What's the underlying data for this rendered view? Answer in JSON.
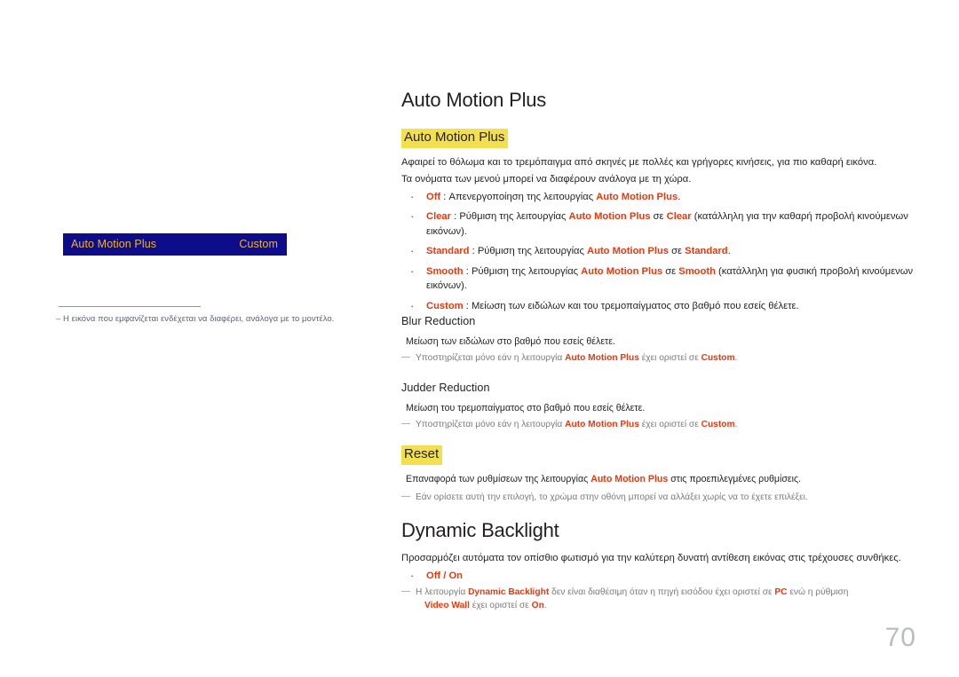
{
  "page": {
    "number": "70"
  },
  "osd": {
    "label": "Auto Motion Plus",
    "value": "Custom",
    "note_dash": "‒",
    "note": "Η εικόνα που εμφανίζεται ενδέχεται να διαφέρει, ανάλογα με το μοντέλο."
  },
  "colors": {
    "osd_background": "#0d0d8c",
    "osd_text": "#f0b323",
    "highlight": "#f2e04e",
    "accent_red": "#e8380d",
    "note_grey": "#7b7b7b",
    "page_number": "#b9bcc2"
  },
  "sections": {
    "auto_motion_plus": {
      "title": "Auto Motion Plus",
      "highlight_heading": "Auto Motion Plus",
      "intro_line_1": "Αφαιρεί το θόλωμα και το τρεμόπαιγμα από σκηνές με πολλές και γρήγορες κινήσεις, για πιο καθαρή εικόνα.",
      "intro_line_2": "Τα ονόματα των μενού μπορεί να διαφέρουν ανάλογα με τη χώρα.",
      "options": [
        {
          "key": "Off",
          "sep": " : ",
          "text_before": "Απενεργοποίηση της λειτουργίας ",
          "ref": "Auto Motion Plus",
          "text_after": "."
        },
        {
          "key": "Clear",
          "sep": " : ",
          "text_before": "Ρύθμιση της λειτουργίας ",
          "ref": "Auto Motion Plus",
          "mid": " σε ",
          "ref2": "Clear",
          "text_after": " (κατάλληλη για την καθαρή προβολή κινούμενων εικόνων)."
        },
        {
          "key": "Standard",
          "sep": " : ",
          "text_before": "Ρύθμιση της λειτουργίας ",
          "ref": "Auto Motion Plus",
          "mid": " σε ",
          "ref2": "Standard",
          "text_after": "."
        },
        {
          "key": "Smooth",
          "sep": " : ",
          "text_before": "Ρύθμιση της λειτουργίας ",
          "ref": "Auto Motion Plus",
          "mid": " σε ",
          "ref2": "Smooth",
          "text_after": " (κατάλληλη για φυσική προβολή κινούμενων εικόνων)."
        },
        {
          "key": "Custom",
          "sep": " : ",
          "text_before": "Μείωση των ειδώλων και του τρεμοπαίγματος στο βαθμό που εσείς θέλετε.",
          "ref": "",
          "text_after": ""
        }
      ]
    },
    "blur_reduction": {
      "heading": "Blur Reduction",
      "description": "Μείωση των ειδώλων στο βαθμό που εσείς θέλετε.",
      "note_dash": "―",
      "note_before": "Υποστηρίζεται μόνο εάν η λειτουργία ",
      "note_ref": "Auto Motion Plus",
      "note_mid": " έχει οριστεί σε ",
      "note_ref2": "Custom",
      "note_after": "."
    },
    "judder_reduction": {
      "heading": "Judder Reduction",
      "description": "Μείωση του τρεμοπαίγματος στο βαθμό που εσείς θέλετε.",
      "note_dash": "―",
      "note_before": "Υποστηρίζεται μόνο εάν η λειτουργία ",
      "note_ref": "Auto Motion Plus",
      "note_mid": " έχει οριστεί σε ",
      "note_ref2": "Custom",
      "note_after": "."
    },
    "reset": {
      "highlight_heading": "Reset",
      "description_before": "Επαναφορά των ρυθμίσεων της λειτουργίας ",
      "description_ref": "Auto Motion Plus",
      "description_after": " στις προεπιλεγμένες ρυθμίσεις.",
      "note_dash": "―",
      "note": "Εάν ορίσετε αυτή την επιλογή, το χρώμα στην οθόνη μπορεί να αλλάξει χωρίς να το έχετε επιλέξει."
    },
    "dynamic_backlight": {
      "title": "Dynamic Backlight",
      "description": "Προσαρμόζει αυτόματα τον οπίσθιο φωτισμό για την καλύτερη δυνατή αντίθεση εικόνας στις τρέχουσες συνθήκες.",
      "option": "Off / On",
      "note_dash": "―",
      "note_before": "Η λειτουργία ",
      "note_ref": "Dynamic Backlight",
      "note_mid": " δεν είναι διαθέσιμη όταν η πηγή εισόδου έχει οριστεί σε ",
      "note_ref2": "PC",
      "note_mid2": " ενώ η ρύθμιση ",
      "note_ref3": "Video Wall",
      "note_mid3": " έχει οριστεί σε ",
      "note_ref4": "On",
      "note_after": "."
    }
  }
}
